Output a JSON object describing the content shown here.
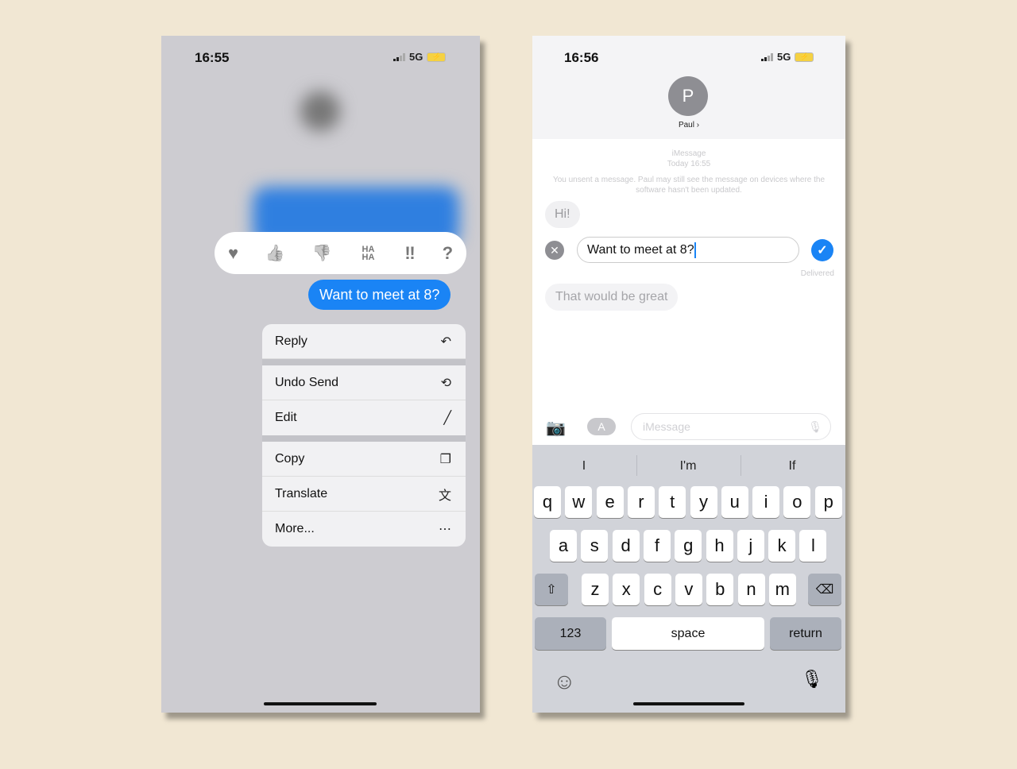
{
  "left_phone": {
    "status": {
      "time": "16:55",
      "network": "5G"
    },
    "reactions": [
      {
        "icon": "heart-icon",
        "glyph": "♥"
      },
      {
        "icon": "thumbs-up-icon",
        "glyph": "👍"
      },
      {
        "icon": "thumbs-down-icon",
        "glyph": "👎"
      },
      {
        "icon": "haha-icon",
        "glyph": "HA HA"
      },
      {
        "icon": "exclamation-icon",
        "glyph": "‼"
      },
      {
        "icon": "question-icon",
        "glyph": "?"
      }
    ],
    "message": "Want to meet at 8?",
    "menu": [
      {
        "label": "Reply",
        "icon": "reply-icon",
        "glyph": "↶"
      },
      {
        "label": "Undo Send",
        "icon": "undo-icon",
        "glyph": "⟲"
      },
      {
        "label": "Edit",
        "icon": "pencil-icon",
        "glyph": "╱"
      },
      {
        "label": "Copy",
        "icon": "copy-icon",
        "glyph": "❐"
      },
      {
        "label": "Translate",
        "icon": "translate-icon",
        "glyph": "文"
      },
      {
        "label": "More...",
        "icon": "more-icon",
        "glyph": "⋯"
      }
    ]
  },
  "right_phone": {
    "status": {
      "time": "16:56",
      "network": "5G"
    },
    "contact": {
      "initial": "P",
      "name": "Paul ›"
    },
    "service": "iMessage",
    "timestamp": "Today 16:55",
    "unsent_note": "You unsent a message. Paul may still see the message on devices where the software hasn't been updated.",
    "received_1": "Hi!",
    "edit_value": "Want to meet at 8?",
    "delivered": "Delivered",
    "received_2": "That would be great",
    "input_placeholder": "iMessage",
    "suggestions": [
      "I",
      "I'm",
      "If"
    ],
    "rows": [
      [
        "q",
        "w",
        "e",
        "r",
        "t",
        "y",
        "u",
        "i",
        "o",
        "p"
      ],
      [
        "a",
        "s",
        "d",
        "f",
        "g",
        "h",
        "j",
        "k",
        "l"
      ],
      [
        "z",
        "x",
        "c",
        "v",
        "b",
        "n",
        "m"
      ]
    ],
    "key_123": "123",
    "key_space": "space",
    "key_return": "return"
  },
  "colors": {
    "accent": "#1a84f5",
    "background": "#f1e7d3"
  }
}
